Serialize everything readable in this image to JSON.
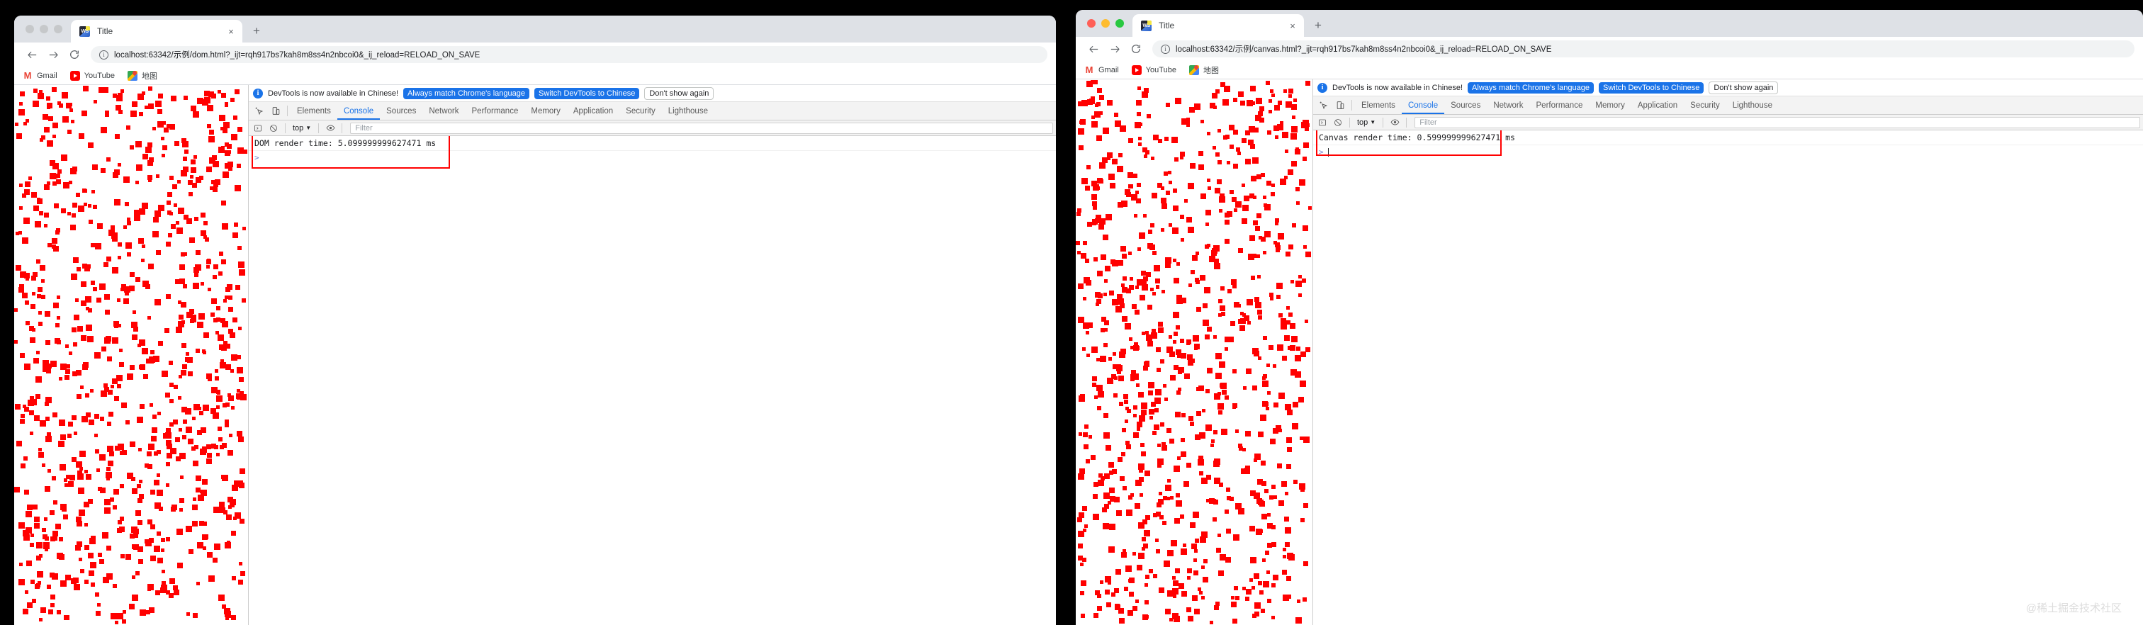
{
  "watermark": "@稀土掘金技术社区",
  "windows": [
    {
      "id": "left",
      "focused": false,
      "tab": {
        "title": "Title",
        "favicon": "webstorm-favicon",
        "close_label": "×",
        "newtab_label": "+"
      },
      "toolbar": {
        "back_label": "back-arrow",
        "forward_label": "forward-arrow",
        "reload_label": "reload-arrow",
        "info_label": "i",
        "url": "localhost:63342/示例/dom.html?_ijt=rqh917bs7kah8m8ss4n2nbcoi0&_ij_reload=RELOAD_ON_SAVE"
      },
      "bookmarks": [
        {
          "label": "Gmail",
          "icon": "gmail-icon"
        },
        {
          "label": "YouTube",
          "icon": "youtube-icon"
        },
        {
          "label": "地图",
          "icon": "maps-icon"
        }
      ],
      "devtools": {
        "banner": {
          "text": "DevTools is now available in Chinese!",
          "buttons": [
            {
              "label": "Always match Chrome's language",
              "style": "blue"
            },
            {
              "label": "Switch DevTools to Chinese",
              "style": "blue"
            },
            {
              "label": "Don't show again",
              "style": "plain"
            }
          ]
        },
        "tabs": [
          "Elements",
          "Console",
          "Sources",
          "Network",
          "Performance",
          "Memory",
          "Application",
          "Security",
          "Lighthouse"
        ],
        "active_tab": "Console",
        "console_bar": {
          "top_label": "top",
          "chevron": "▼",
          "filter_placeholder": "Filter"
        },
        "console_output": "DOM render time: 5.099999999627471 ms",
        "prompt_symbol": ">"
      }
    },
    {
      "id": "right",
      "focused": true,
      "tab": {
        "title": "Title",
        "favicon": "webstorm-favicon",
        "close_label": "×",
        "newtab_label": "+"
      },
      "toolbar": {
        "back_label": "back-arrow",
        "forward_label": "forward-arrow",
        "reload_label": "reload-arrow",
        "info_label": "i",
        "url": "localhost:63342/示例/canvas.html?_ijt=rqh917bs7kah8m8ss4n2nbcoi0&_ij_reload=RELOAD_ON_SAVE"
      },
      "bookmarks": [
        {
          "label": "Gmail",
          "icon": "gmail-icon"
        },
        {
          "label": "YouTube",
          "icon": "youtube-icon"
        },
        {
          "label": "地图",
          "icon": "maps-icon"
        }
      ],
      "devtools": {
        "banner": {
          "text": "DevTools is now available in Chinese!",
          "buttons": [
            {
              "label": "Always match Chrome's language",
              "style": "blue"
            },
            {
              "label": "Switch DevTools to Chinese",
              "style": "blue"
            },
            {
              "label": "Don't show again",
              "style": "plain"
            }
          ]
        },
        "tabs": [
          "Elements",
          "Console",
          "Sources",
          "Network",
          "Performance",
          "Memory",
          "Application",
          "Security",
          "Lighthouse"
        ],
        "active_tab": "Console",
        "console_bar": {
          "top_label": "top",
          "chevron": "▼",
          "filter_placeholder": "Filter"
        },
        "console_output": "Canvas render time: 0.599999999627471 ms",
        "prompt_symbol": ">"
      }
    }
  ],
  "colors": {
    "dot_red": "#ff0000",
    "annotation_red": "#ff0000",
    "accent_blue": "#1a73e8",
    "tabstrip_gray": "#dee1e6"
  }
}
